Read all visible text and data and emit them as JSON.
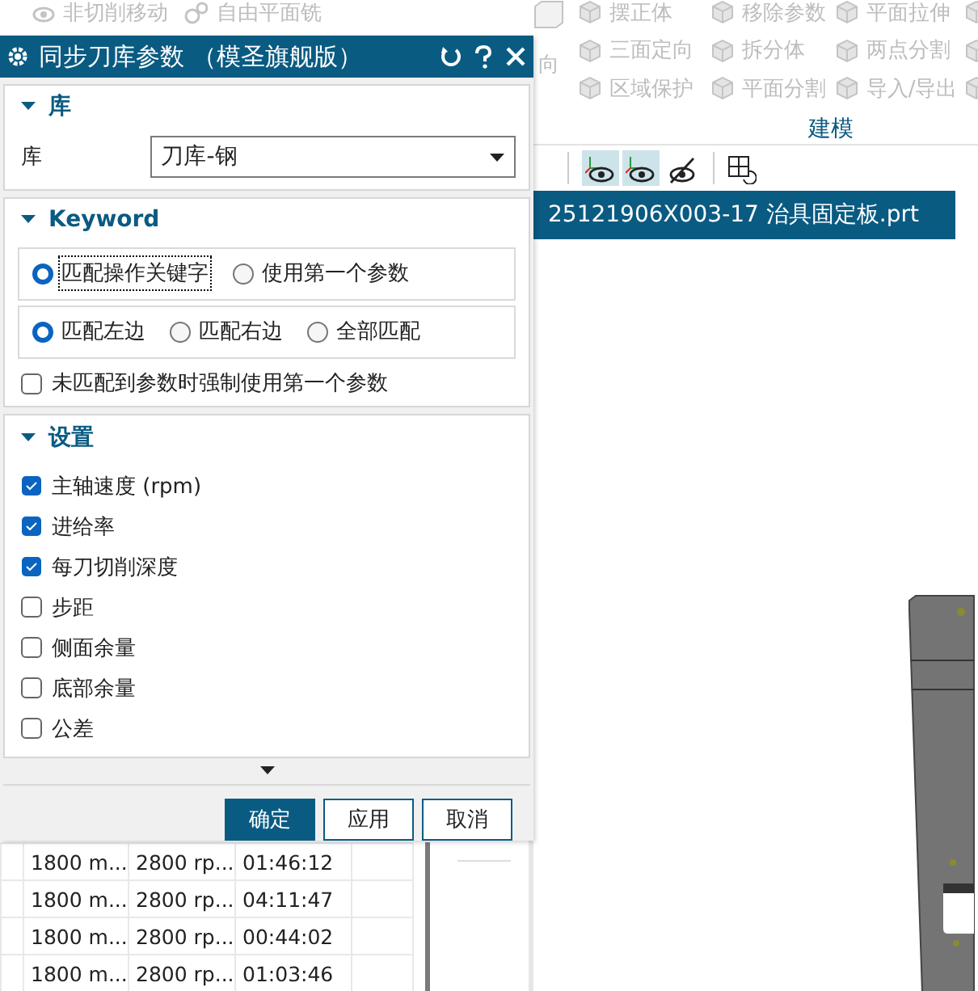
{
  "ribbon": {
    "left_tools": [
      {
        "label": "非切削移动"
      },
      {
        "label": "自由平面铣"
      }
    ],
    "partial_label": "向",
    "tools": [
      {
        "label": "摆正体"
      },
      {
        "label": "移除参数"
      },
      {
        "label": "平面拉伸"
      },
      {
        "label": "三面定向"
      },
      {
        "label": "拆分体"
      },
      {
        "label": "两点分割"
      },
      {
        "label": "区域保护"
      },
      {
        "label": "平面分割"
      },
      {
        "label": "导入/导出"
      }
    ],
    "group_label": "建模"
  },
  "view_toolbar": {
    "toggles": [
      {
        "selected": true
      },
      {
        "selected": true
      },
      {
        "selected": false
      }
    ]
  },
  "document_tab": {
    "title": "25121906X003-17 治具固定板.prt"
  },
  "table": {
    "rows": [
      [
        "1800 m...",
        "2800 rp...",
        "01:46:12"
      ],
      [
        "1800 m...",
        "2800 rp...",
        "04:11:47"
      ],
      [
        "1800 m...",
        "2800 rp...",
        "00:44:02"
      ],
      [
        "1800 m...",
        "2800 rp...",
        "01:03:46"
      ]
    ]
  },
  "dialog": {
    "title": "同步刀库参数 （模圣旗舰版）",
    "library": {
      "title": "库",
      "expanded": true,
      "label": "库",
      "value": "刀库-钢"
    },
    "keyword": {
      "title": "Keyword",
      "expanded": true,
      "radio_groups": [
        [
          {
            "label": "匹配操作关键字",
            "selected": true,
            "focused": true
          },
          {
            "label": "使用第一个参数",
            "selected": false,
            "focused": false
          }
        ],
        [
          {
            "label": "匹配左边",
            "selected": true,
            "focused": false
          },
          {
            "label": "匹配右边",
            "selected": false,
            "focused": false
          },
          {
            "label": "全部匹配",
            "selected": false,
            "focused": false
          }
        ]
      ],
      "force_first": {
        "label": "未匹配到参数时强制使用第一个参数",
        "checked": false
      }
    },
    "settings": {
      "title": "设置",
      "expanded": true,
      "items": [
        {
          "label": "主轴速度 (rpm)",
          "checked": true
        },
        {
          "label": "进给率",
          "checked": true
        },
        {
          "label": "每刀切削深度",
          "checked": true
        },
        {
          "label": "步距",
          "checked": false
        },
        {
          "label": "侧面余量",
          "checked": false
        },
        {
          "label": "底部余量",
          "checked": false
        },
        {
          "label": "公差",
          "checked": false
        }
      ]
    },
    "buttons": [
      {
        "label": "确定",
        "kind": "primary"
      },
      {
        "label": "应用",
        "kind": "normal"
      },
      {
        "label": "取消",
        "kind": "normal"
      }
    ]
  }
}
